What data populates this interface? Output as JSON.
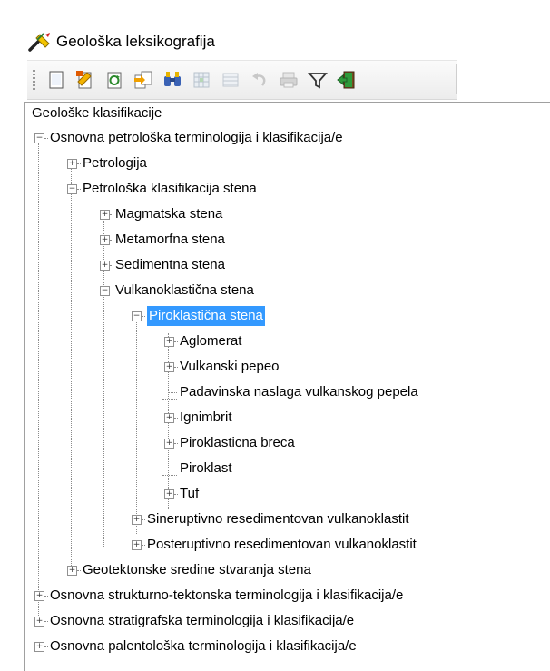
{
  "window": {
    "title": "Geološka leksikografija",
    "app_icon": "wrench-pen-icon"
  },
  "toolbar": {
    "buttons": [
      {
        "name": "new-button",
        "icon": "blank-document-icon",
        "enabled": true
      },
      {
        "name": "edit-button",
        "icon": "edit-document-icon",
        "enabled": true
      },
      {
        "name": "refresh-button",
        "icon": "refresh-icon",
        "enabled": true
      },
      {
        "name": "copy-button",
        "icon": "copy-icon",
        "enabled": true
      },
      {
        "name": "find-button",
        "icon": "binoculars-icon",
        "enabled": true
      },
      {
        "name": "grid-button",
        "icon": "grid-icon",
        "enabled": false
      },
      {
        "name": "table-button",
        "icon": "table-icon",
        "enabled": false
      },
      {
        "name": "undo-button",
        "icon": "undo-icon",
        "enabled": false
      },
      {
        "name": "print-button",
        "icon": "printer-icon",
        "enabled": false
      },
      {
        "name": "filter-button",
        "icon": "filter-icon",
        "enabled": true
      },
      {
        "name": "exit-button",
        "icon": "exit-door-icon",
        "enabled": true
      }
    ]
  },
  "tree": {
    "root": "Geološke klasifikacije",
    "items": [
      {
        "label": "Osnovna petrološka terminologija i klasifikacija/e",
        "expander": "minus"
      },
      {
        "label": "Petrologija",
        "expander": "plus"
      },
      {
        "label": "Petrološka klasifikacija stena",
        "expander": "minus"
      },
      {
        "label": "Magmatska stena",
        "expander": "plus"
      },
      {
        "label": "Metamorfna stena",
        "expander": "plus"
      },
      {
        "label": "Sedimentna stena",
        "expander": "plus"
      },
      {
        "label": "Vulkanoklastična stena",
        "expander": "minus"
      },
      {
        "label": "Piroklastična stena",
        "expander": "minus",
        "selected": true
      },
      {
        "label": "Aglomerat",
        "expander": "plus"
      },
      {
        "label": "Vulkanski pepeo",
        "expander": "plus"
      },
      {
        "label": "Padavinska naslaga vulkanskog pepela",
        "expander": "none"
      },
      {
        "label": "Ignimbrit",
        "expander": "plus"
      },
      {
        "label": "Piroklasticna breca",
        "expander": "plus"
      },
      {
        "label": "Piroklast",
        "expander": "none"
      },
      {
        "label": "Tuf",
        "expander": "plus"
      },
      {
        "label": "Sineruptivno resedimentovan vulkanoklastit",
        "expander": "plus"
      },
      {
        "label": "Posteruptivno resedimentovan vulkanoklastit",
        "expander": "plus"
      },
      {
        "label": "Geotektonske sredine stvaranja stena",
        "expander": "plus"
      },
      {
        "label": "Osnovna strukturno-tektonska terminologija i klasifikacija/e",
        "expander": "plus"
      },
      {
        "label": "Osnovna stratigrafska terminologija i klasifikacija/e",
        "expander": "plus"
      },
      {
        "label": "Osnovna palentološka terminologija i klasifikacija/e",
        "expander": "plus"
      }
    ]
  },
  "colors": {
    "selection": "#3399ff",
    "treeline": "#8a8a8a"
  }
}
